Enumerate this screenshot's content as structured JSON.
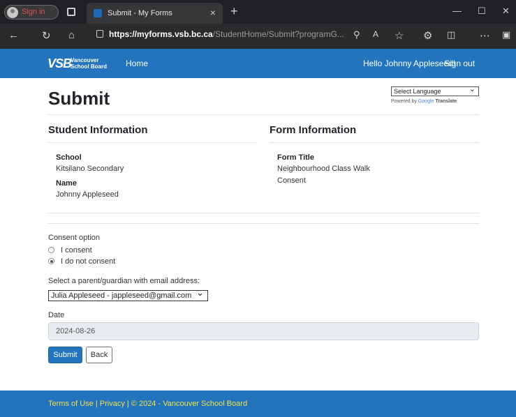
{
  "browser": {
    "profile_label": "Sign in",
    "tab_title": "Submit - My Forms",
    "tab_close": "×",
    "new_tab": "+",
    "url_host": "https://myforms.vsb.bc.ca",
    "url_path": "/StudentHome/Submit?programG...",
    "window_minimize": "—",
    "window_maximize": "☐",
    "window_close": "✕",
    "icons": [
      "back-arrow-icon",
      "refresh-icon",
      "home-icon",
      "lock-icon",
      "zoom-icon",
      "read-aloud-icon",
      "favorite-icon",
      "extensions-icon",
      "split-screen-icon",
      "more-icon",
      "sidebar-icon"
    ]
  },
  "header": {
    "logo_mark": "VSB",
    "logo_line1": "Vancouver",
    "logo_line2": "School Board",
    "home": "Home",
    "greeting": "Hello Johnny Appleseed!",
    "signout": "Sign out",
    "bg_color": "#2274bd"
  },
  "page": {
    "title": "Submit",
    "language_select": "Select Language",
    "powered_by": "Powered by",
    "powered_google": "Google",
    "powered_translate": "Translate"
  },
  "student": {
    "heading": "Student Information",
    "school_label": "School",
    "school_value": "Kitsilano Secondary",
    "name_label": "Name",
    "name_value": "Johnny Appleseed"
  },
  "form_info": {
    "heading": "Form Information",
    "title_label": "Form Title",
    "title_line1": "Neighbourhood Class Walk",
    "title_line2": "Consent"
  },
  "consent": {
    "label": "Consent option",
    "options": [
      {
        "label": "I consent",
        "checked": false
      },
      {
        "label": "I do not consent",
        "checked": true
      }
    ]
  },
  "guardian": {
    "label": "Select a parent/guardian with email address:",
    "selected": "Julia Appleseed - jappleseed@gmail.com"
  },
  "date": {
    "label": "Date",
    "value": "2024-08-26"
  },
  "buttons": {
    "submit": "Submit",
    "back": "Back"
  },
  "footer": {
    "text": "Terms of Use | Privacy | © 2024 - Vancouver School Board",
    "text_color": "#f4e04d"
  }
}
